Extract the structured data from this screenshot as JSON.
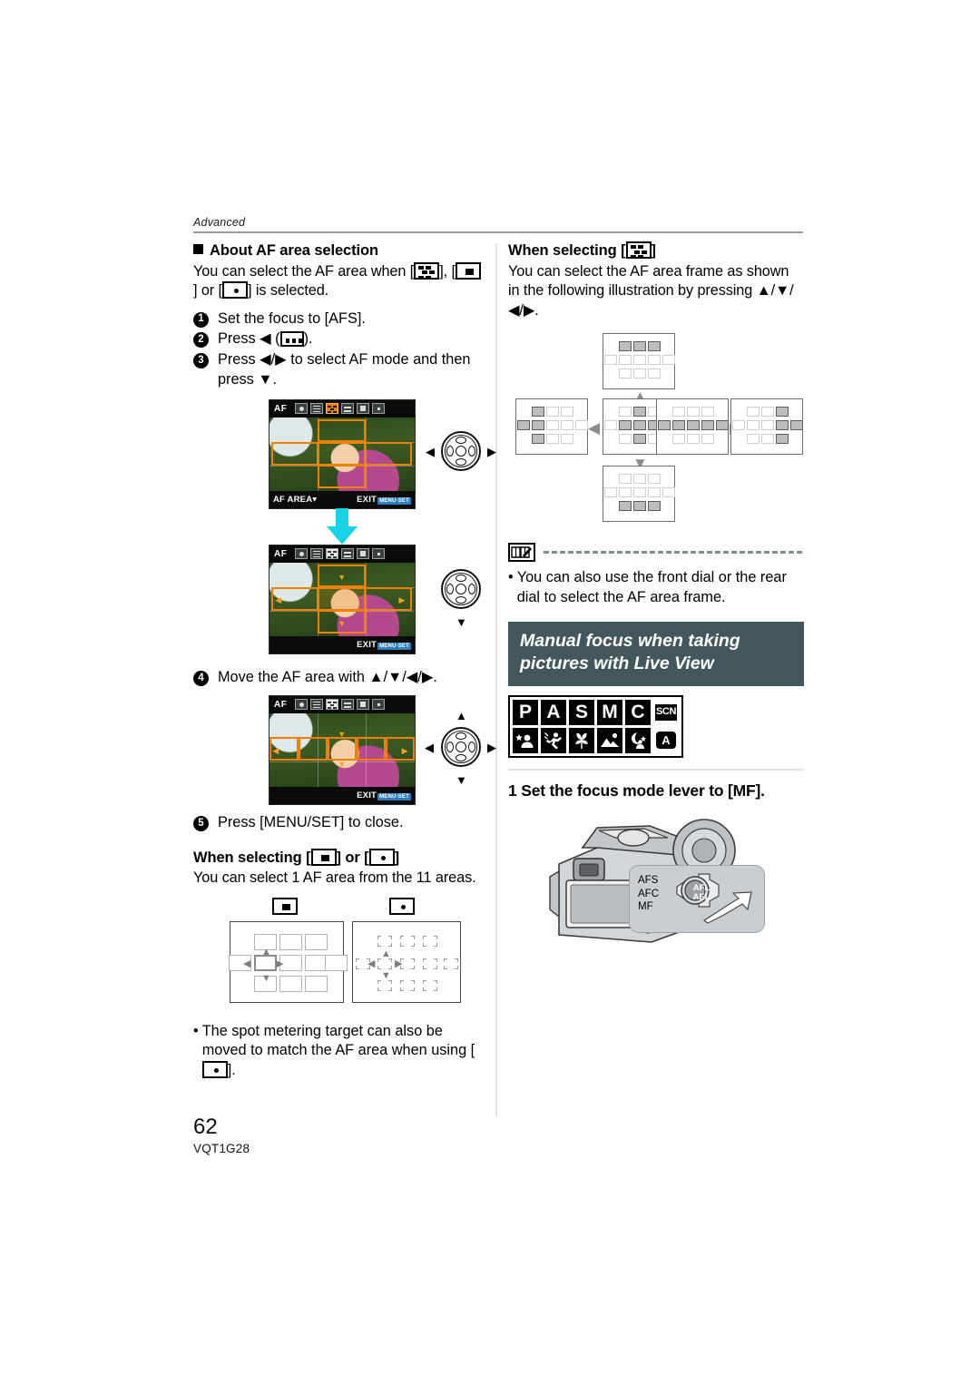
{
  "document": {
    "running_head": "Advanced",
    "page_number": "62",
    "part_number": "VQT1G28"
  },
  "left_column": {
    "heading": "About AF area selection",
    "intro_part1": "You can select the AF area when [",
    "intro_part2": "], [",
    "intro_part3": "] or [",
    "intro_part4": "] is selected.",
    "steps": [
      {
        "num": "1",
        "text": "Set the focus to [AFS]."
      },
      {
        "num": "2",
        "text_before": "Press ◀ (",
        "text_after": ")."
      },
      {
        "num": "3",
        "text": "Press ◀/▶ to select AF mode and then press ▼."
      },
      {
        "num": "4",
        "text": "Move the AF area with ▲/▼/◀/▶."
      },
      {
        "num": "5",
        "text": "Press [MENU/SET] to close."
      }
    ],
    "lcd_screens": [
      {
        "af_label": "AF",
        "bottom_left": "AF AREA▾",
        "bottom_right": "EXIT",
        "menu_key": "MENU·SET"
      },
      {
        "af_label": "AF",
        "bottom_left": "",
        "bottom_right": "EXIT",
        "menu_key": "MENU·SET"
      },
      {
        "af_label": "AF",
        "bottom_left": "",
        "bottom_right": "EXIT",
        "menu_key": "MENU·SET"
      }
    ],
    "subheading_part1": "When selecting [",
    "subheading_part2": "] or [",
    "subheading_part3": "]",
    "sub_body": "You can select 1 AF area from the 11 areas.",
    "bullet_part1": "The spot metering target can also be moved to match the AF area when using [",
    "bullet_part2": "]."
  },
  "right_column": {
    "heading_part1": "When selecting [",
    "heading_part2": "]",
    "body": "You can select the AF area frame as shown in the following illustration by pressing ▲/▼/◀/▶.",
    "note": "You can also use the front dial or the rear dial to select the AF area frame.",
    "banner_line1": "Manual focus when taking",
    "banner_line2": "pictures with Live View",
    "mode_badges_row1": [
      "P",
      "A",
      "S",
      "M",
      "C",
      "SCN"
    ],
    "mode_badges_row2": [
      "portrait",
      "sports",
      "macro",
      "scenery",
      "night-portrait",
      "auto"
    ],
    "step_number": "1",
    "step_title": "Set the focus mode lever to [MF].",
    "camera_lever_labels": [
      "AFS",
      "AFC",
      "MF"
    ],
    "camera_lock_label_line1": "AFL",
    "camera_lock_label_line2": "AEL"
  },
  "colors": {
    "banner_bg": "#44585c",
    "af_frame": "#f08000",
    "cyan_arrow": "#18d3e8",
    "rule": "#9a9a9a",
    "divider": "#dfe4e4",
    "note_dash": "#7c8f92"
  }
}
